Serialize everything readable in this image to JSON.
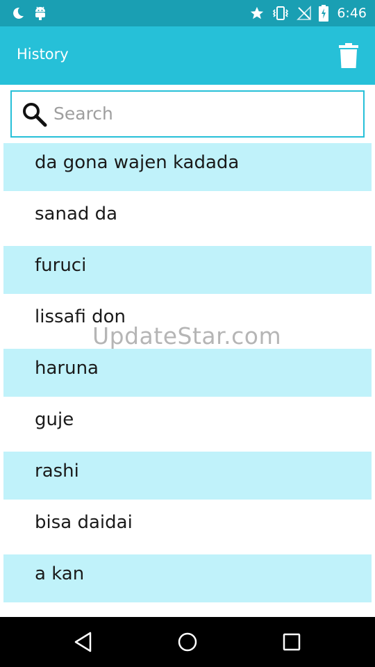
{
  "status_bar": {
    "time": "6:46",
    "icons": [
      "moon-icon",
      "android-icon",
      "star-icon",
      "vibrate-icon",
      "no-signal-icon",
      "battery-charging-icon"
    ]
  },
  "app_bar": {
    "title": "History",
    "action_icon": "trash-icon"
  },
  "search": {
    "placeholder": "Search",
    "value": ""
  },
  "history": {
    "items": [
      {
        "label": "da gona wajen kadada"
      },
      {
        "label": "sanad da"
      },
      {
        "label": "furuci"
      },
      {
        "label": "lissafi don"
      },
      {
        "label": "haruna"
      },
      {
        "label": "guje"
      },
      {
        "label": "rashi"
      },
      {
        "label": "bisa daidai"
      },
      {
        "label": "a kan"
      }
    ]
  },
  "watermark": "UpdateStar.com",
  "nav_bar": {
    "icons": [
      "back-icon",
      "home-icon",
      "recents-icon"
    ]
  },
  "colors": {
    "status_bar": "#1a9fb3",
    "app_bar": "#26c0d8",
    "row_highlight": "#c0f2fa",
    "search_border": "#26c0d8"
  }
}
